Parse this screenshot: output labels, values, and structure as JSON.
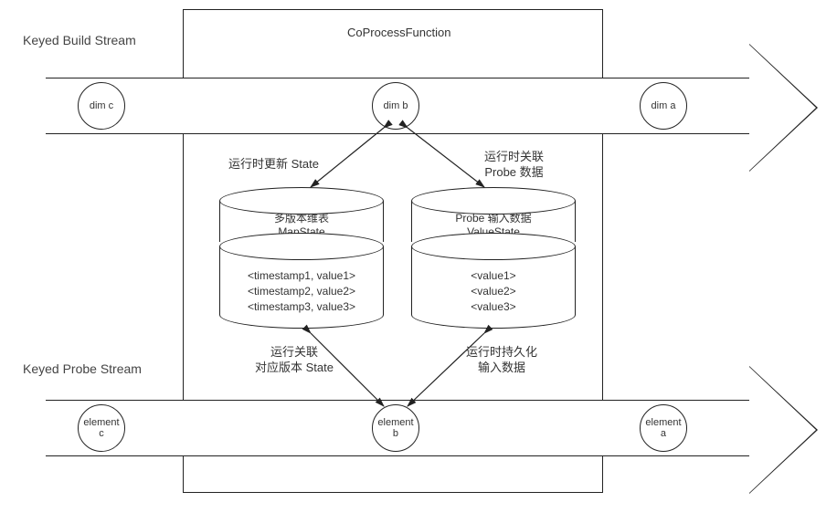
{
  "streams": {
    "build_label": "Keyed Build Stream",
    "probe_label": "Keyed Probe Stream"
  },
  "function_title": "CoProcessFunction",
  "build_nodes": {
    "c": "dim c",
    "b": "dim b",
    "a": "dim a"
  },
  "probe_nodes": {
    "c": "element\nc",
    "b": "element\nb",
    "a": "element\na"
  },
  "annotations": {
    "top_left": "运行时更新 State",
    "top_right_1": "运行时关联",
    "top_right_2": "Probe 数据",
    "bottom_left_1": "运行关联",
    "bottom_left_2": "对应版本 State",
    "bottom_right_1": "运行时持久化",
    "bottom_right_2": "输入数据"
  },
  "left_cylinder": {
    "title_1": "多版本维表",
    "title_2": "MapState",
    "row1": "<timestamp1, value1>",
    "row2": "<timestamp2, value2>",
    "row3": "<timestamp3, value3>"
  },
  "right_cylinder": {
    "title_1": "Probe 输入数据",
    "title_2": "ValueState",
    "row1": "<value1>",
    "row2": "<value2>",
    "row3": "<value3>"
  }
}
